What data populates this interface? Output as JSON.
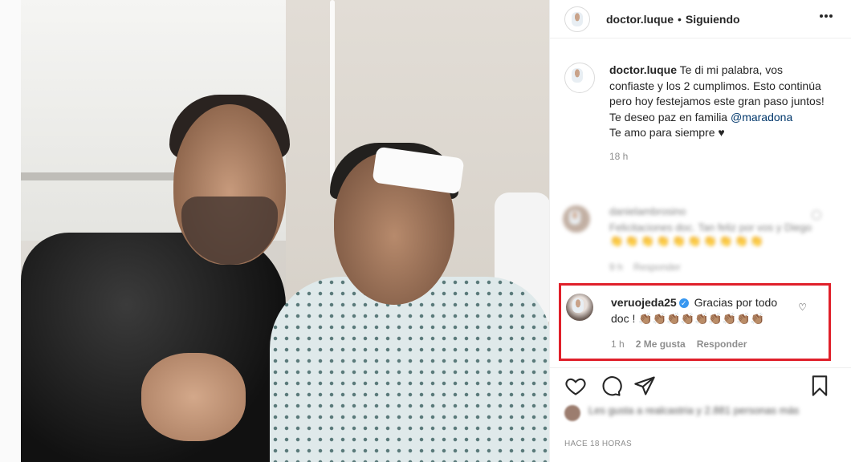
{
  "header": {
    "username": "doctor.luque",
    "separator": "•",
    "follow_status": "Siguiendo"
  },
  "caption": {
    "username": "doctor.luque",
    "text_before_mention": "Te di mi palabra, vos confiaste y los 2 cumplimos. Esto continúa pero hoy festejamos este gran paso juntos! Te deseo paz en familia ",
    "mention": "@maradona",
    "text_after": "Te amo para siempre ♥",
    "time": "18 h"
  },
  "blurred_comment": {
    "username": "danielambrosino",
    "text": "Felicitaciones doc. Tan feliz por vos y Diego",
    "emojis": "👏👏👏👏👏👏👏👏👏👏",
    "time": "9 h",
    "reply_label": "Responder"
  },
  "highlighted_comment": {
    "username": "veruojeda25",
    "verified_mark": "✓",
    "text": "Gracias por todo doc ! 👏🏽👏🏽👏🏽👏🏽👏🏽👏🏽👏🏽👏🏽👏🏽",
    "time": "1 h",
    "likes": "2 Me gusta",
    "reply_label": "Responder",
    "heart": "♡"
  },
  "likes_summary": {
    "text": "Les gusta a realcastria y 2.881 personas más"
  },
  "posted_time": "HACE 18 HORAS",
  "colors": {
    "highlight": "#e0202a",
    "verified": "#3897f0",
    "mention": "#00376b"
  },
  "icons": [
    "more-icon",
    "heart-icon",
    "comment-icon",
    "share-icon",
    "save-icon",
    "verified-icon"
  ]
}
